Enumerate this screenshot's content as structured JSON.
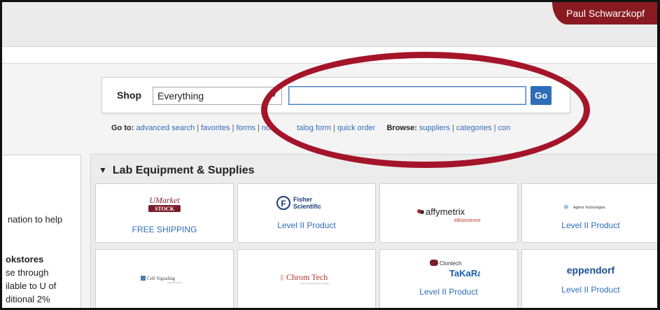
{
  "header": {
    "user_name": "Paul Schwarzkopf"
  },
  "search": {
    "shop_label": "Shop",
    "scope_value": "Everything",
    "input_value": "",
    "go_label": "Go"
  },
  "links": {
    "goto_label": "Go to:",
    "goto_items": [
      "advanced search",
      "favorites",
      "forms",
      "no",
      "talog form",
      "quick order"
    ],
    "browse_label": "Browse:",
    "browse_items": [
      "suppliers",
      "categories",
      "con"
    ]
  },
  "left_panel": {
    "line1": "nation to help",
    "line2": "okstores",
    "line3": "se through",
    "line4": "ilable to U of",
    "line5": "ditional 2%"
  },
  "section": {
    "title": "Lab Equipment & Supplies",
    "cards": [
      {
        "logo": "UMarket STOCK",
        "caption": "FREE SHIPPING"
      },
      {
        "logo": "Fisher Scientific",
        "caption": "Level II Product"
      },
      {
        "logo": "affymetrix",
        "logo_sub": "eBioscience",
        "caption": ""
      },
      {
        "logo": "Agilent Technologies",
        "caption": "Level II Product"
      },
      {
        "logo": "Cell Signaling",
        "caption": ""
      },
      {
        "logo": "Chrom Tech",
        "caption": ""
      },
      {
        "logo": "Clontech",
        "logo_sub": "TaKaRa",
        "caption": "Level II Product"
      },
      {
        "logo": "eppendorf",
        "caption": "Level II Product"
      }
    ]
  },
  "colors": {
    "brand_maroon": "#8a1a22",
    "link_blue": "#2f6dba",
    "annotation_red": "#a4152a"
  }
}
